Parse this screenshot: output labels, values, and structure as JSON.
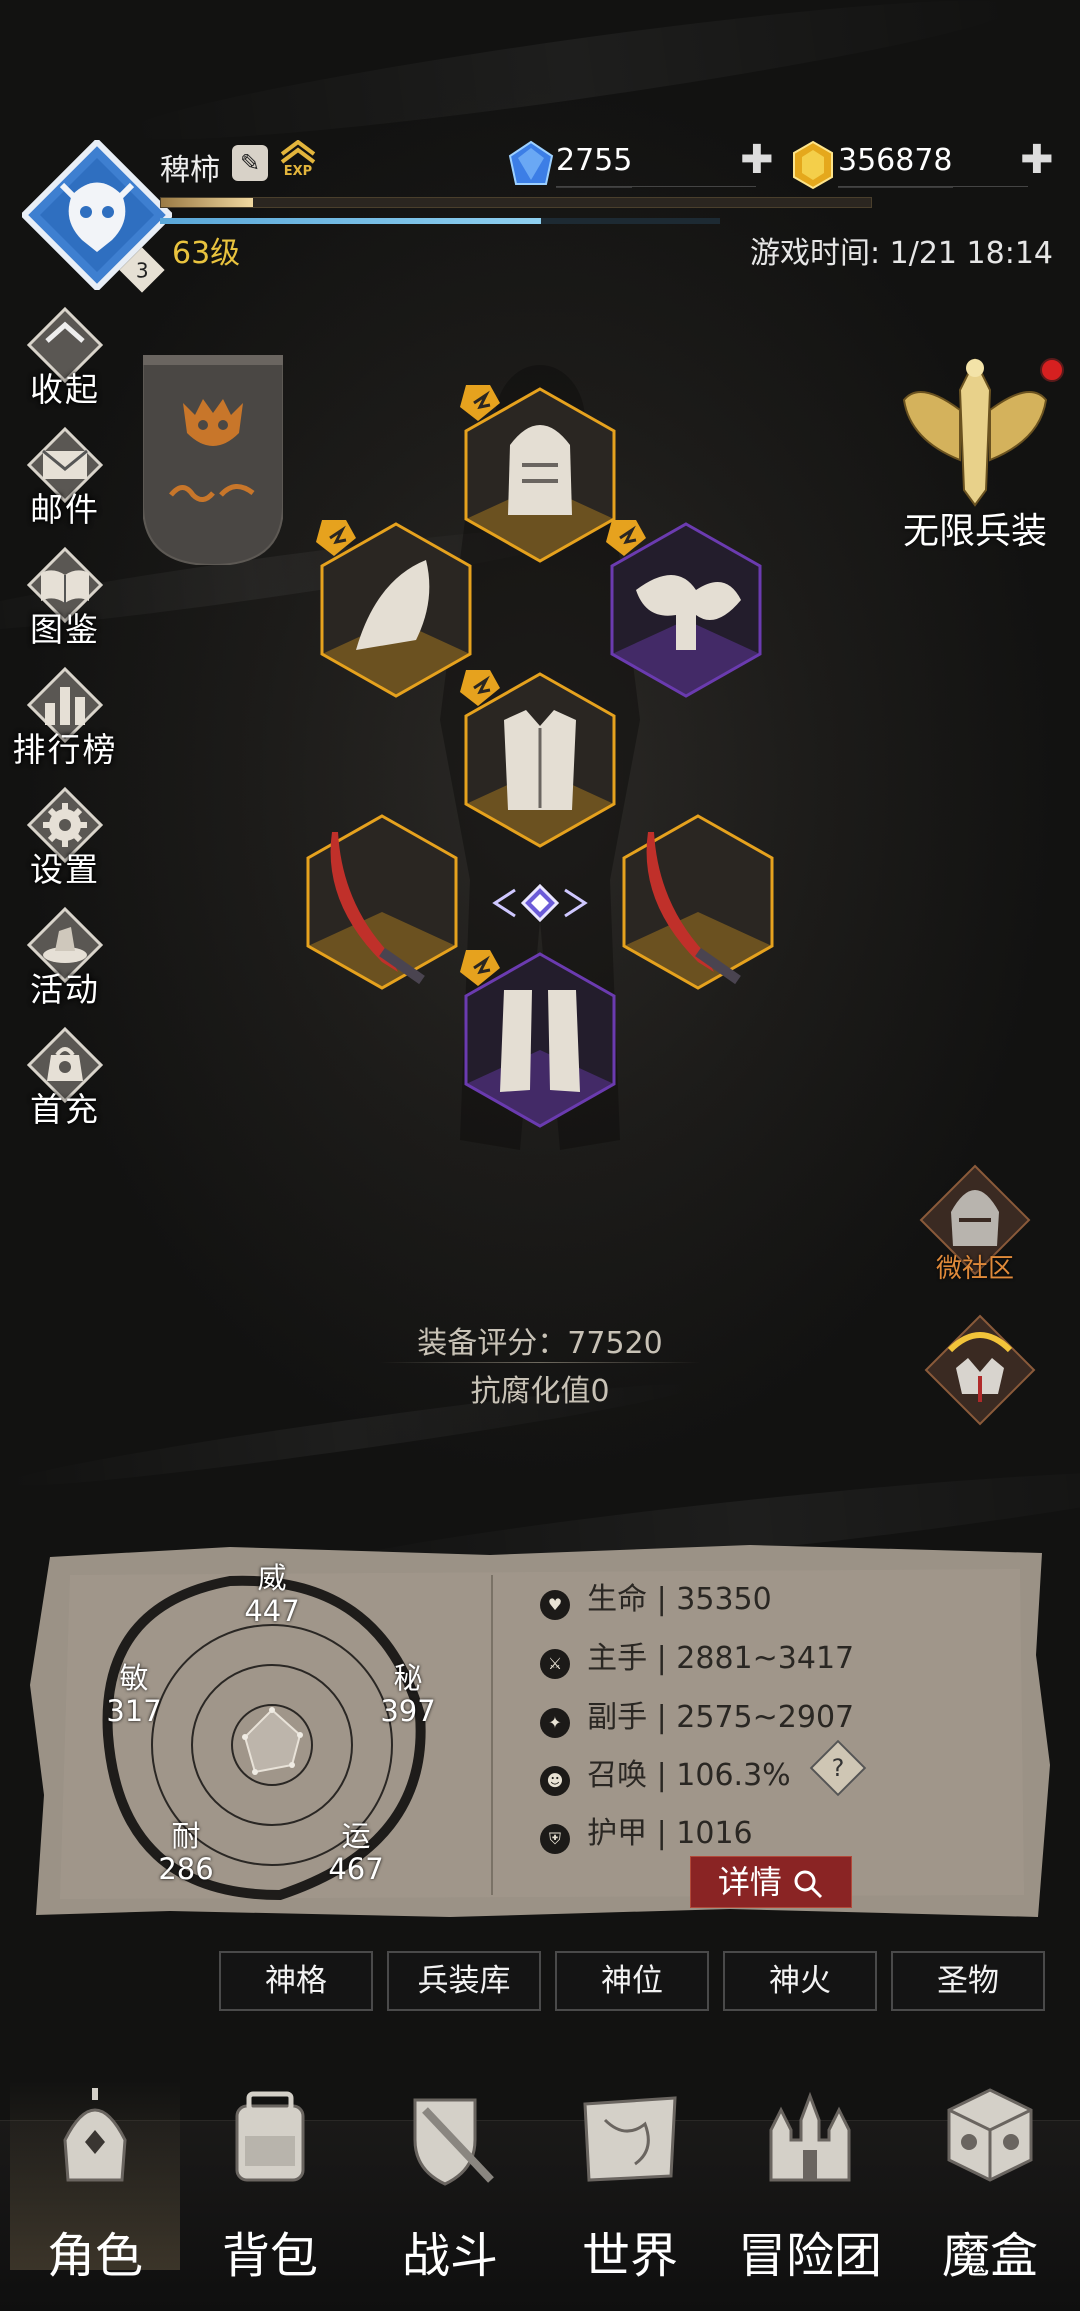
{
  "player": {
    "name": "稗柿",
    "level_text": "63级",
    "rank_badge": "3",
    "exp_progress": 0.13,
    "hp_progress": 0.68,
    "exp_icon_label": "EXP"
  },
  "currency": {
    "gems": "2755",
    "gold": "356878",
    "plus": "✚"
  },
  "game_time": "游戏时间: 1/21 18:14",
  "sidebar": {
    "items": [
      {
        "label": "收起",
        "icon": "collapse-icon"
      },
      {
        "label": "邮件",
        "icon": "mail-icon"
      },
      {
        "label": "图鉴",
        "icon": "book-icon"
      },
      {
        "label": "排行榜",
        "icon": "ranking-icon"
      },
      {
        "label": "设置",
        "icon": "gear-icon"
      },
      {
        "label": "活动",
        "icon": "event-icon"
      },
      {
        "label": "首充",
        "icon": "first-recharge-icon"
      }
    ]
  },
  "right_side": {
    "infinite_label": "无限兵装",
    "community_label": "微社区"
  },
  "equipment": {
    "score_text": "装备评分：77520",
    "anti_corruption_text": "抗腐化值0",
    "slots": [
      "helmet",
      "shoulder-left",
      "shoulder-right",
      "chest",
      "weapon-left",
      "weapon-right",
      "legs"
    ]
  },
  "attributes": {
    "wei": {
      "label": "威",
      "value": "447"
    },
    "mi": {
      "label": "秘",
      "value": "397"
    },
    "yun": {
      "label": "运",
      "value": "467"
    },
    "nai": {
      "label": "耐",
      "value": "286"
    },
    "min": {
      "label": "敏",
      "value": "317"
    }
  },
  "stats": [
    {
      "label": "生命",
      "value": "35350",
      "icon": "heart-icon"
    },
    {
      "label": "主手",
      "value": "2881~3417",
      "icon": "sword-icon"
    },
    {
      "label": "副手",
      "value": "2575~2907",
      "icon": "offhand-icon"
    },
    {
      "label": "召唤",
      "value": "106.3%",
      "icon": "summon-icon"
    },
    {
      "label": "护甲",
      "value": "1016",
      "icon": "armor-icon"
    }
  ],
  "help_glyph": "?",
  "detail_button": "详情",
  "tabs": [
    "神格",
    "兵装库",
    "神位",
    "神火",
    "圣物"
  ],
  "nav": [
    "角色",
    "背包",
    "战斗",
    "世界",
    "冒险团",
    "魔盒"
  ],
  "colors": {
    "gold_accent": "#e9c33e",
    "purple_rarity": "#6b3bb0",
    "orange_rarity": "#e6a21e",
    "detail_red": "#8a2424"
  }
}
